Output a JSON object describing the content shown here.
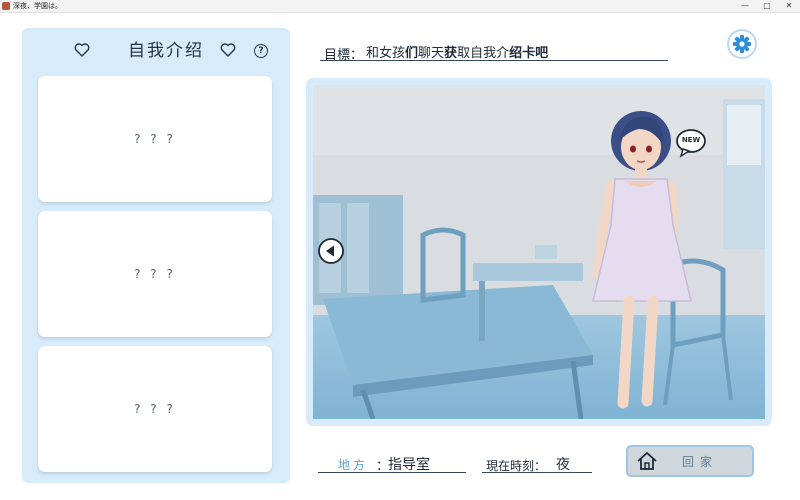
{
  "window": {
    "title": "深夜、学園は。",
    "minimize": "—",
    "maximize": "▢",
    "close": "✕"
  },
  "intro_panel": {
    "title": "自我介绍",
    "help": "?",
    "cards": [
      "? ? ?",
      "? ? ?",
      "? ? ?"
    ]
  },
  "goal": {
    "label": "目標：",
    "text_parts": [
      "和女孩",
      "们",
      "聊天",
      "获",
      "取自我介",
      "绍卡吧"
    ]
  },
  "scene": {
    "badge": "NEW"
  },
  "location": {
    "label": "地方",
    "colon": "：",
    "value": "指导室"
  },
  "time": {
    "label": "現在時刻：",
    "value": "夜"
  },
  "home_button": {
    "label": "回家"
  },
  "colors": {
    "panel": "#d7ebfa",
    "accent": "#2f8fd6",
    "text": "#1f2a36"
  }
}
